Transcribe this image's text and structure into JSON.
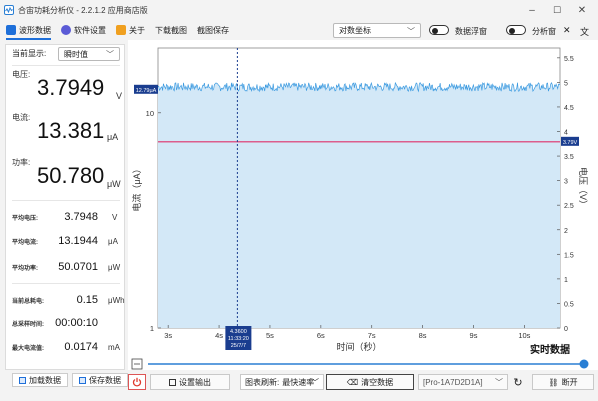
{
  "window": {
    "title": "合宙功耗分析仪 - 2.2.1.2 应用商店版",
    "minimize": "–",
    "maximize": "☐",
    "close": "✕"
  },
  "toolbar": {
    "items": [
      {
        "label": "波形数据",
        "icon": "waveform-icon",
        "color": "#1e6fd9"
      },
      {
        "label": "软件设置",
        "icon": "gear-icon",
        "color": "#5b5bd6"
      },
      {
        "label": "关于",
        "icon": "info-icon",
        "color": "#f0a020"
      },
      {
        "label": "下载截图",
        "icon": "",
        "color": ""
      },
      {
        "label": "截图保存",
        "icon": "",
        "color": ""
      }
    ],
    "scale_select": "对数坐标",
    "data_float_label": "数据浮窗",
    "analysis_label": "分析窗"
  },
  "left": {
    "display_label": "当前显示:",
    "display_value": "瞬时值",
    "voltage": {
      "label": "电压:",
      "value": "3.7949",
      "unit": "V"
    },
    "current": {
      "label": "电流:",
      "value": "13.381",
      "unit": "μA"
    },
    "power": {
      "label": "功率:",
      "value": "50.780",
      "unit": "μW"
    },
    "avg_voltage": {
      "label": "平均电压:",
      "value": "3.7948",
      "unit": "V"
    },
    "avg_current": {
      "label": "平均电流:",
      "value": "13.1944",
      "unit": "μA"
    },
    "avg_power": {
      "label": "平均功率:",
      "value": "50.0701",
      "unit": "μW"
    },
    "total_energy": {
      "label": "当前总耗电:",
      "value": "0.15",
      "unit": "μWh"
    },
    "total_time": {
      "label": "总采样时间:",
      "value": "00:00:10",
      "unit": ""
    },
    "max_current": {
      "label": "最大电流值:",
      "value": "0.0174",
      "unit": "mA"
    }
  },
  "bottom_left": {
    "load": "加载数据",
    "save": "保存数据"
  },
  "chart_data": {
    "type": "line",
    "title": "实时数据",
    "xlabel": "时间（秒）",
    "ylabel_left": "电流（μA）",
    "ylabel_right": "电压（V）",
    "x_ticks": [
      "3s",
      "4s",
      "5s",
      "6s",
      "7s",
      "8s",
      "9s",
      "10s"
    ],
    "xlim": [
      2.8,
      10.7
    ],
    "left_scale": "log",
    "left_ticks": [
      "10",
      "1"
    ],
    "ylim_left": [
      1,
      20
    ],
    "right_ticks": [
      "0",
      "0.5",
      "1",
      "1.5",
      "2",
      "2.5",
      "3",
      "3.5",
      "4",
      "4.5",
      "5",
      "5.5"
    ],
    "ylim_right": [
      0,
      5.7
    ],
    "series": [
      {
        "color": "#3b9ae0",
        "mean": 13.2,
        "noise": 0.6,
        "axis": "left"
      },
      {
        "color": "#e0306a",
        "value": 3.79,
        "axis": "right"
      }
    ],
    "current_marker": "12.79μA",
    "voltage_marker": "3.79V",
    "cursor": {
      "x": 4.36,
      "label_value": "4.3600",
      "label_time": "11:33:20",
      "label_date": "25/7/7"
    }
  },
  "statusbar": {
    "power_icon": "power-icon",
    "settings_output": "设置输出",
    "refresh_label": "图表刷新:",
    "refresh_value": "最快速率",
    "clear": "清空数据",
    "device": "[Pro-1A7D2D1A]",
    "disconnect": "断开"
  }
}
